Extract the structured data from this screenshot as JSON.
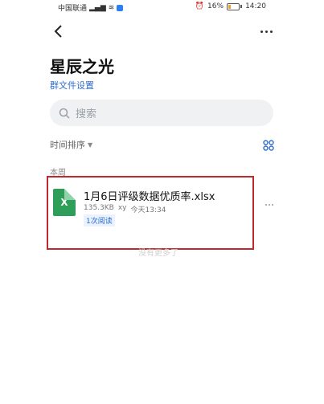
{
  "status_bar": {
    "carrier": "中国联通",
    "signal_text": "ᵃˡˡ",
    "battery": "16%",
    "time": "14:20"
  },
  "header": {
    "group_name": "星辰之光",
    "settings_link": "群文件设置"
  },
  "search": {
    "placeholder": "搜索"
  },
  "toolbar": {
    "sort_label": "时间排序"
  },
  "files": {
    "section_label": "本周",
    "items": [
      {
        "icon_letter": "X",
        "name": "1月6日评级数据优质率.xlsx",
        "size": "135.3KB",
        "uploader": "xy",
        "time": "今天13:34",
        "read_count": "1次阅读"
      }
    ],
    "end_text": "没有更多了"
  },
  "icons": {
    "back": "chevron-left-icon",
    "more": "more-icon",
    "search": "search-icon",
    "grid": "grid-view-icon",
    "file": "excel-file-icon"
  },
  "colors": {
    "link": "#2f6ecf",
    "highlight_border": "#c0282e",
    "excel_green": "#2e9e58"
  }
}
